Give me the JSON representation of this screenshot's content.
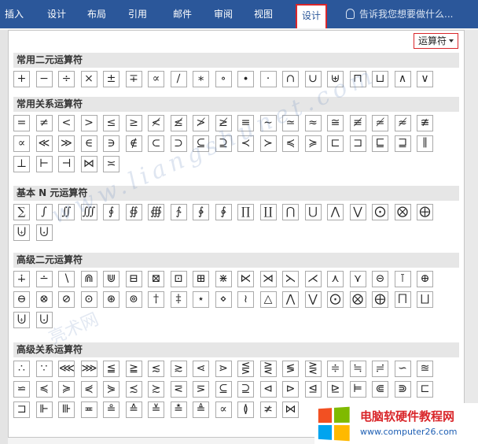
{
  "ribbon": {
    "tabs": [
      "插入",
      "设计",
      "布局",
      "引用",
      "邮件",
      "审阅",
      "视图",
      "设计"
    ],
    "active_tab_index": 7,
    "tell_me": "告诉我您想要做什么..."
  },
  "category_dropdown": {
    "label": "运算符"
  },
  "sections": [
    {
      "title": "常用二元运算符",
      "symbols": [
        "+",
        "−",
        "÷",
        "×",
        "±",
        "∓",
        "∝",
        "∕",
        "∗",
        "∘",
        "∙",
        "⋅",
        "∩",
        "∪",
        "⊎",
        "⊓",
        "⊔",
        "∧",
        "∨"
      ]
    },
    {
      "title": "常用关系运算符",
      "symbols": [
        "=",
        "≠",
        "<",
        ">",
        "≤",
        "≥",
        "≮",
        "≰",
        "≯",
        "≱",
        "≡",
        "∼",
        "≃",
        "≈",
        "≅",
        "≢",
        "≄",
        "≉",
        "≇",
        "∝",
        "≪",
        "≫",
        "∈",
        "∋",
        "∉",
        "⊂",
        "⊃",
        "⊆",
        "⊇",
        "≺",
        "≻",
        "≼",
        "≽",
        "⊏",
        "⊐",
        "⊑",
        "⊒",
        "∥",
        "⊥",
        "⊢",
        "⊣",
        "⋈",
        "≍"
      ]
    },
    {
      "title": "基本 N 元运算符",
      "symbols": [
        "∑",
        "∫",
        "∬",
        "∭",
        "∮",
        "∯",
        "∰",
        "∱",
        "∲",
        "∳",
        "∏",
        "∐",
        "⋂",
        "⋃",
        "⋀",
        "⋁",
        "⨀",
        "⨂",
        "⨁",
        "⨄",
        "⨃"
      ]
    },
    {
      "title": "高级二元运算符",
      "symbols": [
        "∔",
        "∸",
        "∖",
        "⋒",
        "⋓",
        "⊟",
        "⊠",
        "⊡",
        "⊞",
        "⋇",
        "⋉",
        "⋊",
        "⋋",
        "⋌",
        "⋏",
        "⋎",
        "⊝",
        "⊺",
        "⊕",
        "⊖",
        "⊗",
        "⊘",
        "⊙",
        "⊛",
        "⊚",
        "†",
        "‡",
        "⋆",
        "⋄",
        "≀",
        "△",
        "⋀",
        "⋁",
        "⨀",
        "⨂",
        "⨁",
        "⨅",
        "⨆",
        "⨄",
        "⨃"
      ]
    },
    {
      "title": "高级关系运算符",
      "symbols": [
        "∴",
        "∵",
        "⋘",
        "⋙",
        "≦",
        "≧",
        "≲",
        "≳",
        "⋖",
        "⋗",
        "⋚",
        "⋛",
        "≶",
        "⋛",
        "≑",
        "≒",
        "≓",
        "∽",
        "≊",
        "⋍",
        "≼",
        "≽",
        "⋞",
        "⋟",
        "≾",
        "≿",
        "⋜",
        "⋝",
        "⊆",
        "⊇",
        "⊲",
        "⊳",
        "⊴",
        "⊵",
        "⊨",
        "⋐",
        "⋑",
        "⊏",
        "⊐",
        "⊩",
        "⊪",
        "≖",
        "≗",
        "≙",
        "≚",
        "≛",
        "≜",
        "∝",
        "≬",
        "≭",
        "⋈"
      ]
    }
  ],
  "watermark": {
    "url": "www.liangshunet.com",
    "cn": "亮术网"
  },
  "badge": {
    "title": "电脑软硬件教程网",
    "url": "www.computer26.com"
  },
  "colors": {
    "ribbon": "#2b579a",
    "highlight_border": "#d9262a",
    "section_header_bg": "#e6e6e6"
  }
}
